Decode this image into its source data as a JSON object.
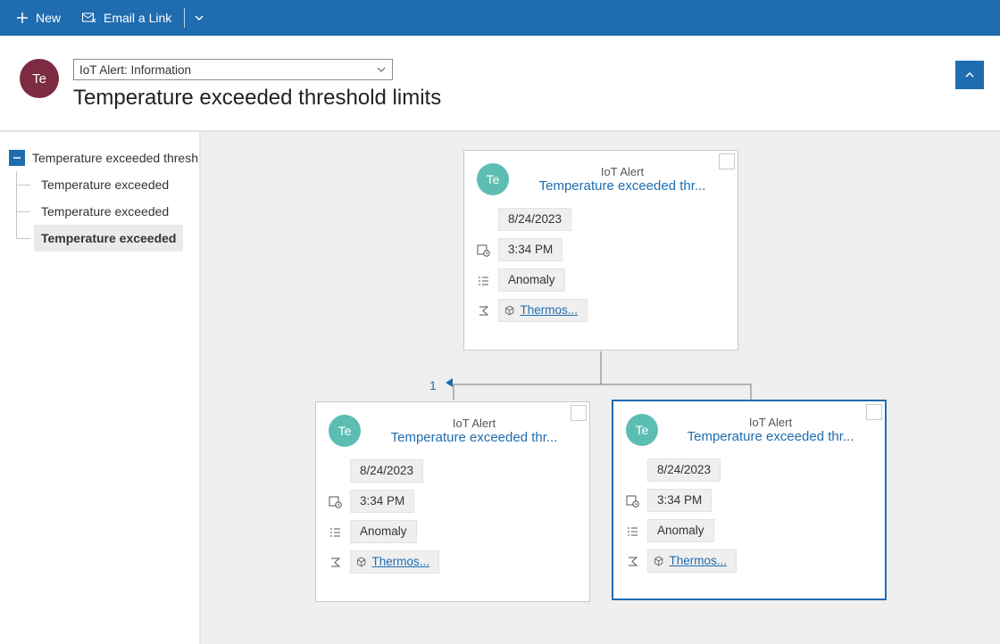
{
  "cmd": {
    "new": "New",
    "email": "Email a Link"
  },
  "header": {
    "avatar": "Te",
    "form_selector": "IoT Alert: Information",
    "title": "Temperature exceeded threshold limits"
  },
  "tree": {
    "root": "Temperature exceeded thresh",
    "children": [
      "Temperature exceeded",
      "Temperature exceeded",
      "Temperature exceeded"
    ],
    "selected_index": 2
  },
  "diagram": {
    "pager_count": "1",
    "cards": [
      {
        "avatar": "Te",
        "type": "IoT Alert",
        "title": "Temperature exceeded thr...",
        "date": "8/24/2023",
        "time": "3:34 PM",
        "status": "Anomaly",
        "device": "Thermos..."
      },
      {
        "avatar": "Te",
        "type": "IoT Alert",
        "title": "Temperature exceeded thr...",
        "date": "8/24/2023",
        "time": "3:34 PM",
        "status": "Anomaly",
        "device": "Thermos..."
      },
      {
        "avatar": "Te",
        "type": "IoT Alert",
        "title": "Temperature exceeded thr...",
        "date": "8/24/2023",
        "time": "3:34 PM",
        "status": "Anomaly",
        "device": "Thermos..."
      }
    ],
    "selected_card": 2
  }
}
